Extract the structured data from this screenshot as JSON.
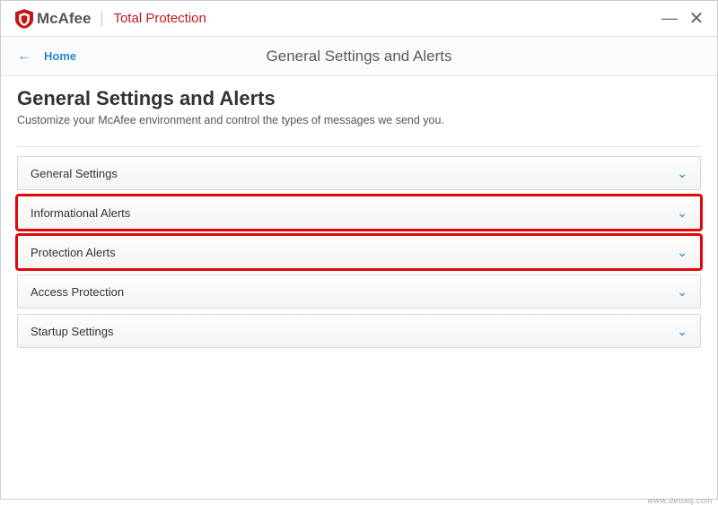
{
  "brand": {
    "name": "McAfee",
    "product": "Total Protection",
    "accent": "#c01818"
  },
  "window": {
    "minimize": "—",
    "close": "✕"
  },
  "nav": {
    "home_label": "Home",
    "title": "General Settings and Alerts"
  },
  "page": {
    "title": "General Settings and Alerts",
    "subtitle": "Customize your McAfee environment and control the types of messages we send you."
  },
  "rows": {
    "general": "General Settings",
    "info_alerts": "Informational Alerts",
    "prot_alerts": "Protection Alerts",
    "access": "Access Protection",
    "startup": "Startup Settings"
  },
  "watermark": "www.deuaq.com"
}
